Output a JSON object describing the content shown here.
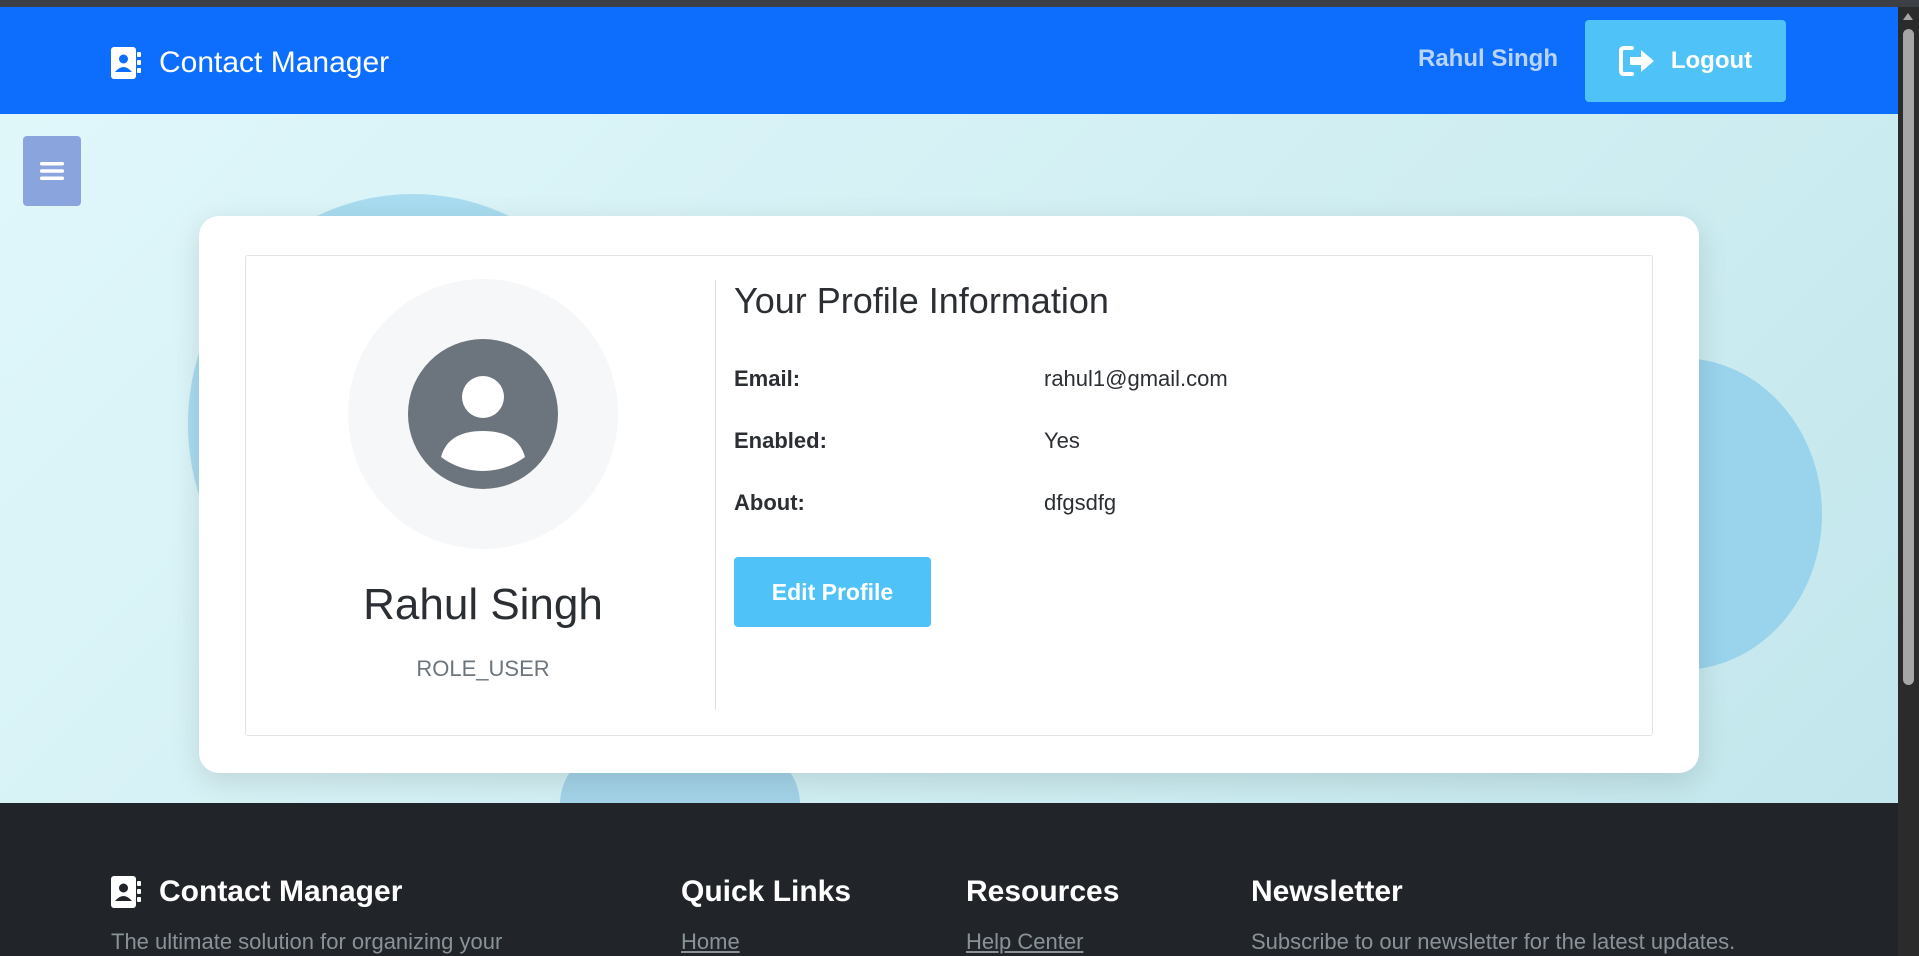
{
  "navbar": {
    "brand": "Contact Manager",
    "brand_icon": "address-book-icon",
    "user_name": "Rahul Singh",
    "logout_label": "Logout",
    "logout_icon": "sign-out-icon",
    "color": "#0d6efd"
  },
  "sidebar_toggle": {
    "icon": "hamburger-menu-icon"
  },
  "profile": {
    "avatar_icon": "user-circle-icon",
    "name": "Rahul Singh",
    "role": "ROLE_USER",
    "info_title": "Your Profile Information",
    "fields": [
      {
        "label": "Email:",
        "value": "rahul1@gmail.com"
      },
      {
        "label": "Enabled:",
        "value": "Yes"
      },
      {
        "label": "About:",
        "value": "dfgsdfg"
      }
    ],
    "edit_label": "Edit Profile",
    "accent_color": "#4fc3f7"
  },
  "footer": {
    "brand": "Contact Manager",
    "brand_text": "The ultimate solution for organizing your",
    "quick_links_title": "Quick Links",
    "quick_links": [
      "Home"
    ],
    "resources_title": "Resources",
    "resources": [
      "Help Center"
    ],
    "newsletter_title": "Newsletter",
    "newsletter_text": "Subscribe to our newsletter for the latest updates."
  }
}
